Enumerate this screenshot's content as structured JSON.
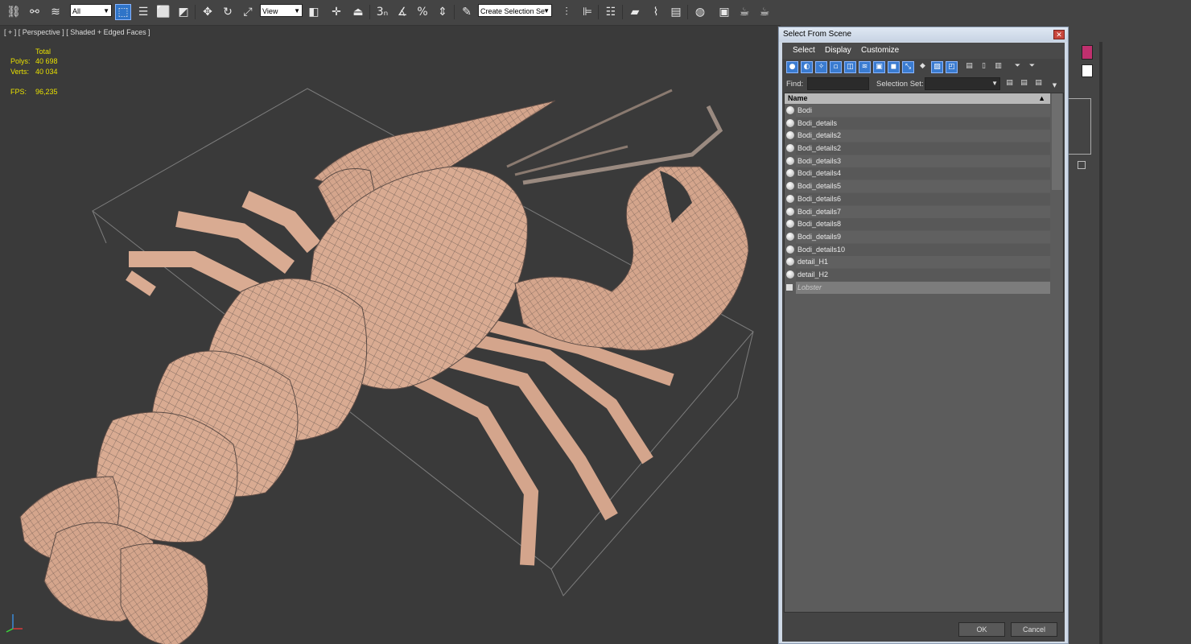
{
  "toolbar": {
    "filter_value": "All",
    "refcoord_value": "View",
    "selection_set_value": "Create Selection Se"
  },
  "viewport": {
    "label": "[ + ] [ Perspective ] [ Shaded + Edged Faces ]",
    "stats": {
      "total_label": "Total",
      "polys_label": "Polys:",
      "polys_value": "40 698",
      "verts_label": "Verts:",
      "verts_value": "40 034",
      "fps_label": "FPS:",
      "fps_value": "96,235"
    }
  },
  "dialog": {
    "title": "Select From Scene",
    "menu": [
      "Select",
      "Display",
      "Customize"
    ],
    "find_label": "Find:",
    "selection_set_label": "Selection Set:",
    "list_header": "Name",
    "items": [
      "Bodi",
      "Bodi_details",
      "Bodi_details2",
      "Bodi_details2",
      "Bodi_details3",
      "Bodi_details4",
      "Bodi_details5",
      "Bodi_details6",
      "Bodi_details7",
      "Bodi_details8",
      "Bodi_details9",
      "Bodi_details10",
      "detail_H1",
      "detail_H2"
    ],
    "group_item": "Lobster",
    "ok_label": "OK",
    "cancel_label": "Cancel"
  },
  "colors": {
    "model": "#d9ab92",
    "wire": "#6a5a52",
    "accent": "#2f74c8",
    "stats": "#e8e000"
  }
}
